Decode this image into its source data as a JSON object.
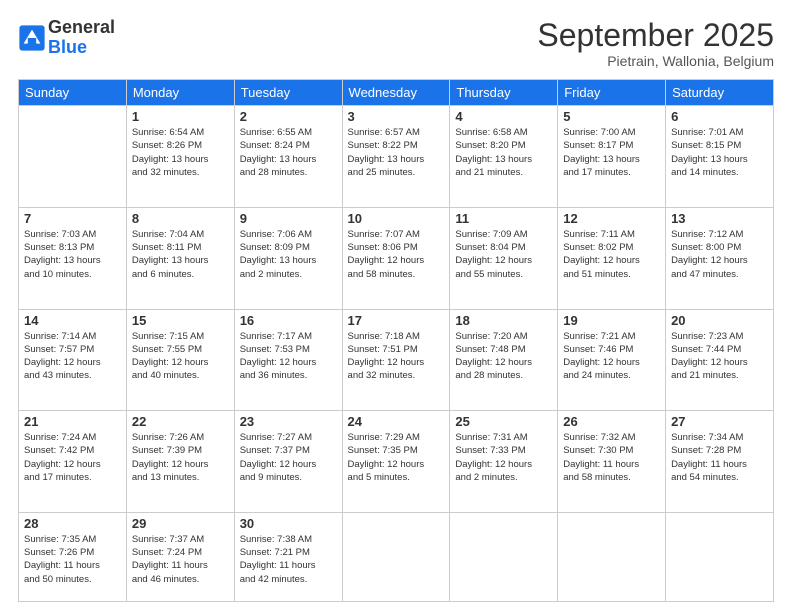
{
  "logo": {
    "general": "General",
    "blue": "Blue"
  },
  "header": {
    "month": "September 2025",
    "location": "Pietrain, Wallonia, Belgium"
  },
  "weekdays": [
    "Sunday",
    "Monday",
    "Tuesday",
    "Wednesday",
    "Thursday",
    "Friday",
    "Saturday"
  ],
  "weeks": [
    [
      {
        "day": "",
        "info": ""
      },
      {
        "day": "1",
        "info": "Sunrise: 6:54 AM\nSunset: 8:26 PM\nDaylight: 13 hours\nand 32 minutes."
      },
      {
        "day": "2",
        "info": "Sunrise: 6:55 AM\nSunset: 8:24 PM\nDaylight: 13 hours\nand 28 minutes."
      },
      {
        "day": "3",
        "info": "Sunrise: 6:57 AM\nSunset: 8:22 PM\nDaylight: 13 hours\nand 25 minutes."
      },
      {
        "day": "4",
        "info": "Sunrise: 6:58 AM\nSunset: 8:20 PM\nDaylight: 13 hours\nand 21 minutes."
      },
      {
        "day": "5",
        "info": "Sunrise: 7:00 AM\nSunset: 8:17 PM\nDaylight: 13 hours\nand 17 minutes."
      },
      {
        "day": "6",
        "info": "Sunrise: 7:01 AM\nSunset: 8:15 PM\nDaylight: 13 hours\nand 14 minutes."
      }
    ],
    [
      {
        "day": "7",
        "info": "Sunrise: 7:03 AM\nSunset: 8:13 PM\nDaylight: 13 hours\nand 10 minutes."
      },
      {
        "day": "8",
        "info": "Sunrise: 7:04 AM\nSunset: 8:11 PM\nDaylight: 13 hours\nand 6 minutes."
      },
      {
        "day": "9",
        "info": "Sunrise: 7:06 AM\nSunset: 8:09 PM\nDaylight: 13 hours\nand 2 minutes."
      },
      {
        "day": "10",
        "info": "Sunrise: 7:07 AM\nSunset: 8:06 PM\nDaylight: 12 hours\nand 58 minutes."
      },
      {
        "day": "11",
        "info": "Sunrise: 7:09 AM\nSunset: 8:04 PM\nDaylight: 12 hours\nand 55 minutes."
      },
      {
        "day": "12",
        "info": "Sunrise: 7:11 AM\nSunset: 8:02 PM\nDaylight: 12 hours\nand 51 minutes."
      },
      {
        "day": "13",
        "info": "Sunrise: 7:12 AM\nSunset: 8:00 PM\nDaylight: 12 hours\nand 47 minutes."
      }
    ],
    [
      {
        "day": "14",
        "info": "Sunrise: 7:14 AM\nSunset: 7:57 PM\nDaylight: 12 hours\nand 43 minutes."
      },
      {
        "day": "15",
        "info": "Sunrise: 7:15 AM\nSunset: 7:55 PM\nDaylight: 12 hours\nand 40 minutes."
      },
      {
        "day": "16",
        "info": "Sunrise: 7:17 AM\nSunset: 7:53 PM\nDaylight: 12 hours\nand 36 minutes."
      },
      {
        "day": "17",
        "info": "Sunrise: 7:18 AM\nSunset: 7:51 PM\nDaylight: 12 hours\nand 32 minutes."
      },
      {
        "day": "18",
        "info": "Sunrise: 7:20 AM\nSunset: 7:48 PM\nDaylight: 12 hours\nand 28 minutes."
      },
      {
        "day": "19",
        "info": "Sunrise: 7:21 AM\nSunset: 7:46 PM\nDaylight: 12 hours\nand 24 minutes."
      },
      {
        "day": "20",
        "info": "Sunrise: 7:23 AM\nSunset: 7:44 PM\nDaylight: 12 hours\nand 21 minutes."
      }
    ],
    [
      {
        "day": "21",
        "info": "Sunrise: 7:24 AM\nSunset: 7:42 PM\nDaylight: 12 hours\nand 17 minutes."
      },
      {
        "day": "22",
        "info": "Sunrise: 7:26 AM\nSunset: 7:39 PM\nDaylight: 12 hours\nand 13 minutes."
      },
      {
        "day": "23",
        "info": "Sunrise: 7:27 AM\nSunset: 7:37 PM\nDaylight: 12 hours\nand 9 minutes."
      },
      {
        "day": "24",
        "info": "Sunrise: 7:29 AM\nSunset: 7:35 PM\nDaylight: 12 hours\nand 5 minutes."
      },
      {
        "day": "25",
        "info": "Sunrise: 7:31 AM\nSunset: 7:33 PM\nDaylight: 12 hours\nand 2 minutes."
      },
      {
        "day": "26",
        "info": "Sunrise: 7:32 AM\nSunset: 7:30 PM\nDaylight: 11 hours\nand 58 minutes."
      },
      {
        "day": "27",
        "info": "Sunrise: 7:34 AM\nSunset: 7:28 PM\nDaylight: 11 hours\nand 54 minutes."
      }
    ],
    [
      {
        "day": "28",
        "info": "Sunrise: 7:35 AM\nSunset: 7:26 PM\nDaylight: 11 hours\nand 50 minutes."
      },
      {
        "day": "29",
        "info": "Sunrise: 7:37 AM\nSunset: 7:24 PM\nDaylight: 11 hours\nand 46 minutes."
      },
      {
        "day": "30",
        "info": "Sunrise: 7:38 AM\nSunset: 7:21 PM\nDaylight: 11 hours\nand 42 minutes."
      },
      {
        "day": "",
        "info": ""
      },
      {
        "day": "",
        "info": ""
      },
      {
        "day": "",
        "info": ""
      },
      {
        "day": "",
        "info": ""
      }
    ]
  ]
}
